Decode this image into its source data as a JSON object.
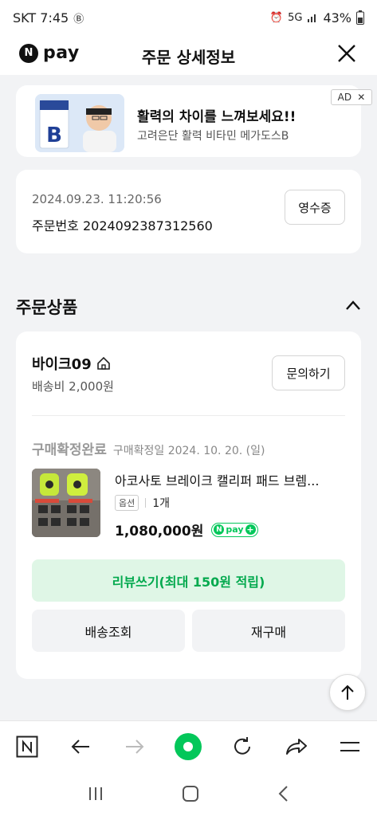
{
  "status_bar": {
    "carrier_time": "SKT 7:45",
    "carrier_icon": "b-icon",
    "network": "5G",
    "battery": "43%"
  },
  "header": {
    "logo_letter": "N",
    "logo_text": "pay",
    "title": "주문 상세정보"
  },
  "ad": {
    "title": "활력의 차이를 느껴보세요!!",
    "subtitle": "고려은단 활력 비타민 메가도스B",
    "badge": "AD"
  },
  "order": {
    "datetime": "2024.09.23. 11:20:56",
    "number": "주문번호 2024092387312560",
    "receipt_label": "영수증"
  },
  "section": {
    "title": "주문상품"
  },
  "product_card": {
    "store_name": "바이크09",
    "shipping_fee": "배송비 2,000원",
    "inquiry_label": "문의하기",
    "status": "구매확정완료",
    "confirm_date": "구매확정일 2024. 10. 20. (일)",
    "product_name": "아코사토 브레이크 캘리퍼 패드 브렘...",
    "option_badge": "옵션",
    "quantity": "1개",
    "price": "1,080,000원",
    "npay_badge": "pay",
    "review_label": "리뷰쓰기(최대 150원 적립)",
    "shipping_track_label": "배송조회",
    "reorder_label": "재구매"
  },
  "colors": {
    "brand_green": "#03c75a",
    "review_bg": "#dff6e6",
    "page_bg": "#f2f3f5"
  }
}
